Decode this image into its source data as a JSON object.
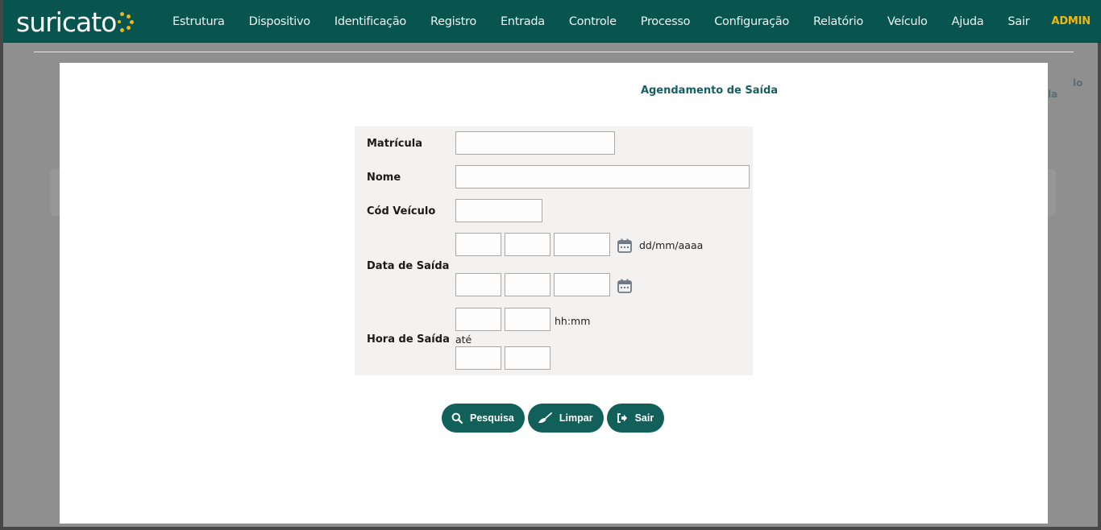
{
  "app": {
    "logo_text": "suricato",
    "user_label": "ADMIN"
  },
  "nav": [
    {
      "label": "Estrutura"
    },
    {
      "label": "Dispositivo"
    },
    {
      "label": "Identificação"
    },
    {
      "label": "Registro"
    },
    {
      "label": "Entrada"
    },
    {
      "label": "Controle"
    },
    {
      "label": "Processo"
    },
    {
      "label": "Configuração"
    },
    {
      "label": "Relatório"
    },
    {
      "label": "Veículo"
    },
    {
      "label": "Ajuda"
    },
    {
      "label": "Sair"
    }
  ],
  "background": {
    "hint_top": "lo",
    "hint_bottom": "la"
  },
  "modal": {
    "title": "Agendamento de Saída",
    "fields": {
      "matricula_label": "Matrícula",
      "nome_label": "Nome",
      "cod_veiculo_label": "Cód Veículo",
      "data_saida_label": "Data de Saída",
      "date_format_hint": "dd/mm/aaaa",
      "hora_saida_label": "Hora de Saída",
      "time_format_hint": "hh:mm",
      "ate_label": "até"
    },
    "buttons": {
      "search": "Pesquisa",
      "clear": "Limpar",
      "exit": "Sair"
    }
  },
  "colors": {
    "topbar": "#08544e",
    "accent": "#f1b713",
    "button": "#11605a",
    "title": "#165f63"
  }
}
